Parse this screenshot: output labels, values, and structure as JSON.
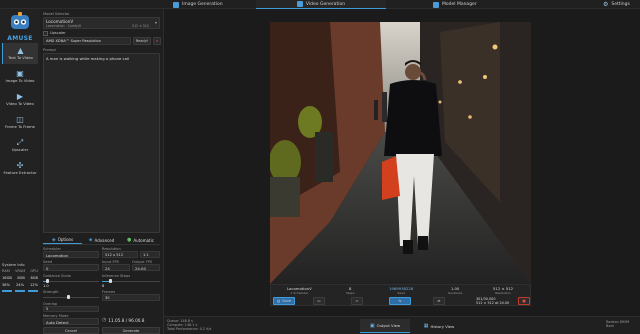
{
  "app": {
    "logo_text": "AMUSE"
  },
  "top_tabs": [
    {
      "label": "Image Generation",
      "icon": "image-icon"
    },
    {
      "label": "Video Generation",
      "icon": "video-icon"
    },
    {
      "label": "Model Manager",
      "icon": "model-icon"
    }
  ],
  "settings_label": "Settings",
  "nav": [
    {
      "label": "Text To Video",
      "icon": "text-video-icon"
    },
    {
      "label": "Image To Video",
      "icon": "image-video-icon"
    },
    {
      "label": "Video To Video",
      "icon": "video-video-icon"
    },
    {
      "label": "Frame To Frame",
      "icon": "frame-icon"
    },
    {
      "label": "Upscaler",
      "icon": "upscaler-icon"
    },
    {
      "label": "Feature Extractor",
      "icon": "extractor-icon"
    }
  ],
  "model_selector": {
    "label": "Model Selector",
    "model": "LocomotionV",
    "sublabel": "Locomotion  ·  ComfyUI",
    "meta": "512 × 512"
  },
  "upscaler": {
    "label": "Upscaler",
    "value": "AMD XDNA™ Super Resolution",
    "status": "Ready!"
  },
  "prompt": {
    "label": "Prompt",
    "text": "A man is walking while making a phone call"
  },
  "settings_tabs": [
    "Options",
    "Advanced",
    "Automatic"
  ],
  "options": {
    "scheduler_label": "Scheduler",
    "scheduler": "Locomotion",
    "resolution_label": "Resolution",
    "resolution": "512 x 512",
    "resolution_extra": "1:1",
    "seed_label": "Seed",
    "seed": "0",
    "input_fps_label": "Input FPS",
    "input_fps": "24",
    "output_fps_label": "Output FPS",
    "output_fps": "24.00",
    "guidance_label": "Guidance Scale",
    "guidance": "1.0",
    "inference_label": "Inference Steps",
    "inference": "8",
    "strength_label": "Strength",
    "frames_label": "Frames",
    "frames": "30",
    "overlap_label": "Overlap",
    "overlap": "5",
    "memory_label": "Memory Mode",
    "memory": "Auto Detect"
  },
  "system_info": {
    "label": "System Info",
    "headers": [
      "RAM",
      "VRAM",
      "GPU"
    ],
    "rows": [
      [
        "16GB",
        "8GB",
        "8GB"
      ],
      [
        "38%",
        "24%",
        "12%"
      ]
    ]
  },
  "actions": {
    "cancel": "Cancel",
    "generate": "Generate"
  },
  "timer": "11.05.8 / 96.00.8",
  "infobar": {
    "columns": [
      {
        "value": "LocomotionV",
        "label": "1 Scheduler"
      },
      {
        "value": "8",
        "label": "Steps"
      },
      {
        "value": "1989938228",
        "label": "Seed"
      },
      {
        "value": "1.00",
        "label": "Guidance"
      },
      {
        "value": "512 × 512",
        "label": "Resolution"
      }
    ],
    "save_label": "Save",
    "res_text": "301/30.000",
    "res_text2": "512 × 512 at 24.00"
  },
  "stats": [
    "Queue: 148.8 s",
    "Compute: 148.1 s",
    "Total Performance: 0.2 it/s"
  ],
  "output_tabs": [
    "Output View",
    "History View"
  ],
  "device": {
    "line1": "Radeon 890M",
    "line2": "Back"
  }
}
